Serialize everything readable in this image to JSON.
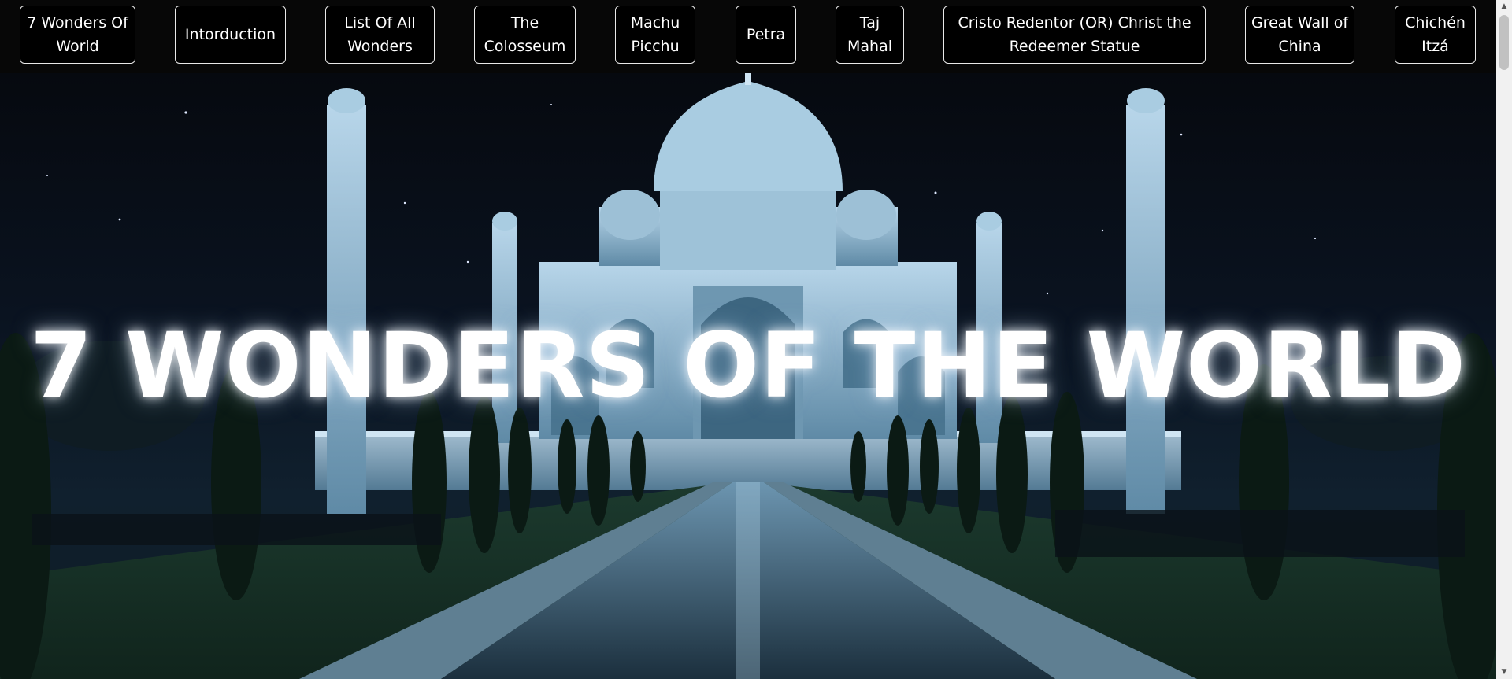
{
  "nav": {
    "items": [
      "7 Wonders Of World",
      "Intorduction",
      "List Of All Wonders",
      "The Colosseum",
      "Machu Picchu",
      "Petra",
      "Taj Mahal",
      "Cristo Redentor (OR) Christ the Redeemer Statue",
      "Great Wall of China",
      "Chichén Itzá"
    ]
  },
  "hero": {
    "title": "7 WONDERS OF THE WORLD",
    "image": "taj-mahal-night-photo"
  },
  "colors": {
    "nav_bg": "#070707",
    "button_border": "#e8e8e8",
    "title_text": "#ffffff",
    "marble_tint": "#9fc4dc"
  },
  "scrollbar": {
    "up_icon": "triangle-up-icon",
    "down_icon": "triangle-down-icon"
  }
}
